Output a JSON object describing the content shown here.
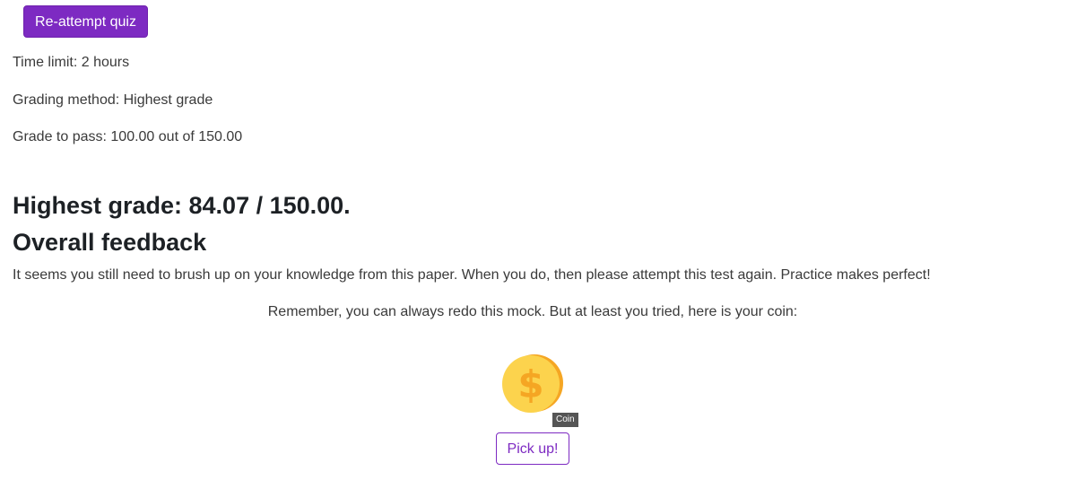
{
  "quiz": {
    "reattempt_label": "Re-attempt quiz",
    "time_limit": "Time limit: 2 hours",
    "grading_method": "Grading method: Highest grade",
    "grade_to_pass": "Grade to pass: 100.00 out of 150.00"
  },
  "results": {
    "highest_grade": "Highest grade: 84.07 / 150.00.",
    "feedback_heading": "Overall feedback",
    "feedback_text": "It seems you still need to brush up on your knowledge from this paper. When you do, then please attempt this test again. Practice makes perfect!",
    "reminder_text": "Remember, you can always redo this mock. But at least you tried, here is your coin:"
  },
  "coin": {
    "icon": "coin-icon",
    "tooltip": "Coin",
    "pickup_label": "Pick up!"
  },
  "colors": {
    "accent": "#7d2ac2",
    "coin_gold": "#fcd34d",
    "coin_edge": "#f5a623"
  }
}
